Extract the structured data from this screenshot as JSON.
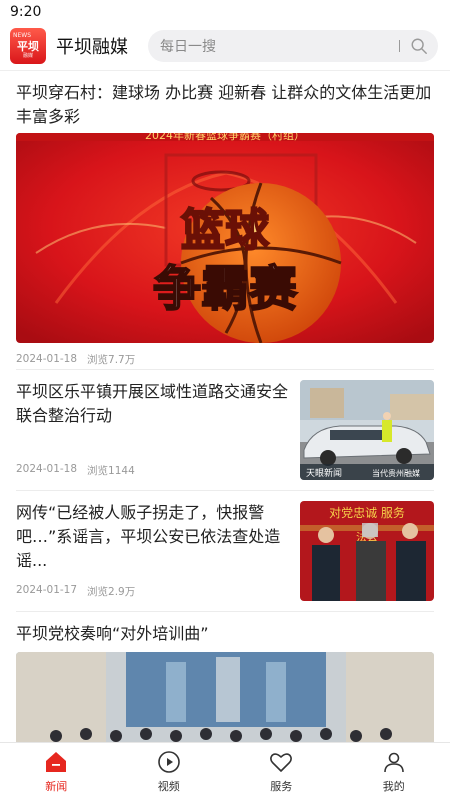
{
  "status_bar": {
    "time": "9:20"
  },
  "header": {
    "logo": {
      "top": "NEWS",
      "main": "平坝",
      "bottom": "融媒"
    },
    "app_name": "平坝融媒",
    "search_placeholder": "每日一搜"
  },
  "news": [
    {
      "title": "平坝穿石村：建球场 办比赛 迎新春 让群众的文体生活更加丰富多彩",
      "date": "2024-01-18",
      "views": "浏览7.7万",
      "image": {
        "headline_text": "2024年新春篮球争霸赛（村组）",
        "line1": "篮球",
        "line2": "争霸赛"
      }
    },
    {
      "title": "平坝区乐平镇开展区域性道路交通安全联合整治行动",
      "date": "2024-01-18",
      "views": "浏览1144",
      "image": {
        "caption": "天眼新闻",
        "caption2": "当代贵州融媒"
      }
    },
    {
      "title": "网传“已经被人贩子拐走了，快报警吧…”系谣言，平坝公安已依法查处造谣...",
      "date": "2024-01-17",
      "views": "浏览2.9万",
      "image": {
        "banner": "对党忠诚 服务",
        "banner2": "法公"
      }
    },
    {
      "title": "平坝党校奏响“对外培训曲”"
    }
  ],
  "tabs": [
    {
      "label": "新闻",
      "icon": "news-home-icon",
      "active": true
    },
    {
      "label": "视频",
      "icon": "video-play-icon",
      "active": false
    },
    {
      "label": "服务",
      "icon": "heart-icon",
      "active": false
    },
    {
      "label": "我的",
      "icon": "profile-icon",
      "active": false
    }
  ],
  "colors": {
    "accent": "#e6271f",
    "search_bg": "#f0f0f2",
    "meta_text": "#999999"
  }
}
